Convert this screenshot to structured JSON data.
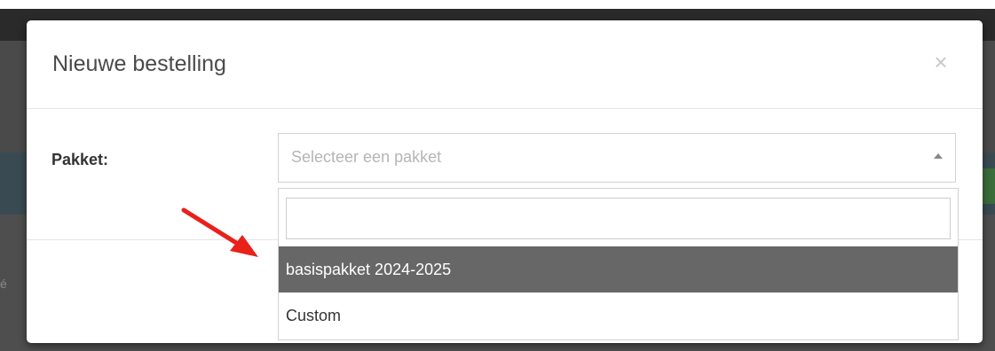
{
  "modal": {
    "title": "Nieuwe bestelling",
    "close_glyph": "×"
  },
  "form": {
    "package_label": "Pakket:",
    "package_select": {
      "placeholder": "Selecteer een pakket",
      "search_value": "",
      "options": [
        {
          "label": "basispakket 2024-2025",
          "highlighted": true
        },
        {
          "label": "Custom",
          "highlighted": false
        }
      ]
    }
  },
  "background": {
    "edge_fragment": "é"
  },
  "annotation": {
    "arrow_color": "#e8211a",
    "arrow_target": "option-basispakket-2024-2025"
  },
  "colors": {
    "highlight": "#676767",
    "placeholder": "#b5b5b5"
  },
  "icons": {
    "close": "close-icon",
    "select_arrow": "caret-up-icon"
  }
}
